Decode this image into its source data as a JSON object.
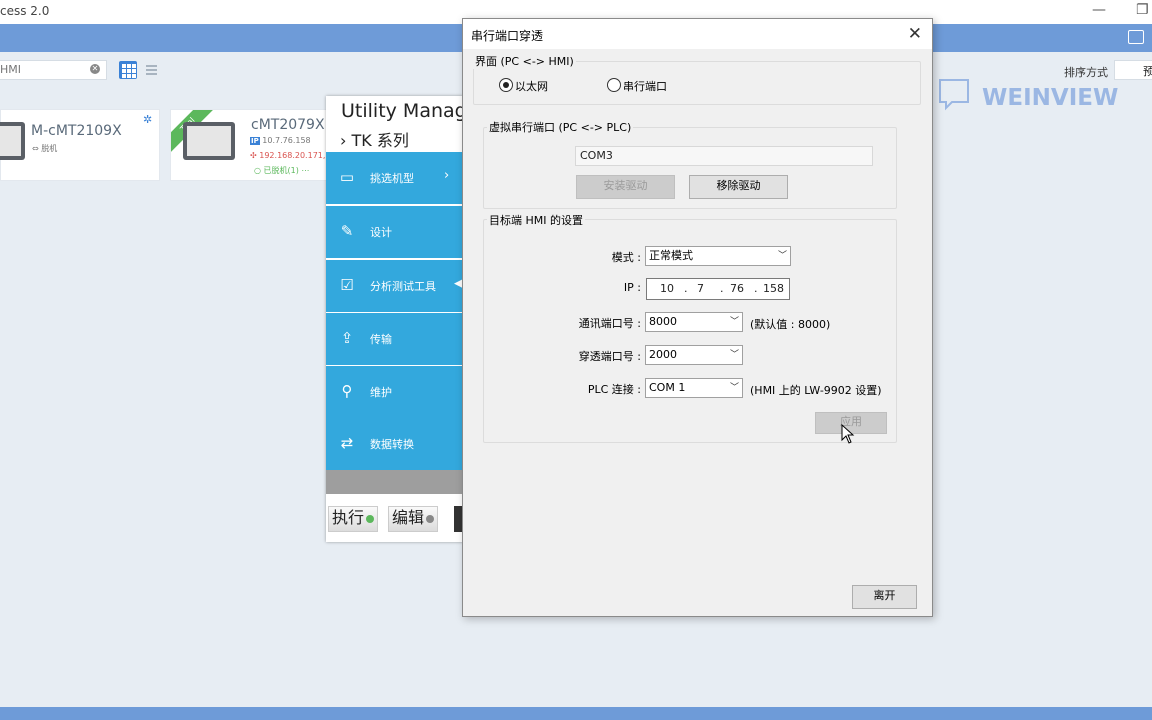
{
  "window": {
    "title": "cess 2.0",
    "minimize": "—",
    "restore": "❐"
  },
  "toolbar": {
    "search_value": "HMI",
    "clear_glyph": "✕",
    "sort_label": "排序方式",
    "sort_value": "预"
  },
  "brand": {
    "logo_text": "WEINVIEW"
  },
  "devices": [
    {
      "name": "M-cMT2109X",
      "status": "脱机"
    },
    {
      "name": "cMT2079X",
      "badge": "Trial",
      "ip1": "10.7.76.158",
      "ip2": "192.168.20.171,",
      "status": "已脱机(1)"
    }
  ],
  "utility": {
    "title": "Utility Manage",
    "series": "› TK 系列",
    "items": [
      {
        "label": "挑选机型",
        "icon": "monitor-icon"
      },
      {
        "label": "设计",
        "icon": "design-icon"
      },
      {
        "label": "分析测试工具",
        "icon": "analysis-icon"
      },
      {
        "label": "传输",
        "icon": "transfer-icon"
      },
      {
        "label": "维护",
        "icon": "maintenance-icon"
      },
      {
        "label": "数据转换",
        "icon": "data-convert-icon"
      }
    ],
    "run_label": "执行",
    "edit_label": "编辑"
  },
  "dialog": {
    "title": "串行端口穿透",
    "interface_group": "界面 (PC <-> HMI)",
    "radio_ethernet": "以太网",
    "radio_serial": "串行端口",
    "virtual_group": "虚拟串行端口 (PC <-> PLC)",
    "virtual_port": "COM3",
    "install_driver": "安装驱动",
    "remove_driver": "移除驱动",
    "target_group": "目标端 HMI 的设置",
    "mode_label": "模式 :",
    "mode_value": "正常模式",
    "ip_label": "IP :",
    "ip": [
      "10",
      "7",
      "76",
      "158"
    ],
    "comm_port_label": "通讯端口号 :",
    "comm_port_value": "8000",
    "comm_port_hint": "(默认值 : 8000)",
    "pass_port_label": "穿透端口号 :",
    "pass_port_value": "2000",
    "plc_label": "PLC 连接 :",
    "plc_value": "COM 1",
    "plc_hint": "(HMI 上的 LW-9902 设置)",
    "apply": "应用",
    "leave": "离开"
  }
}
